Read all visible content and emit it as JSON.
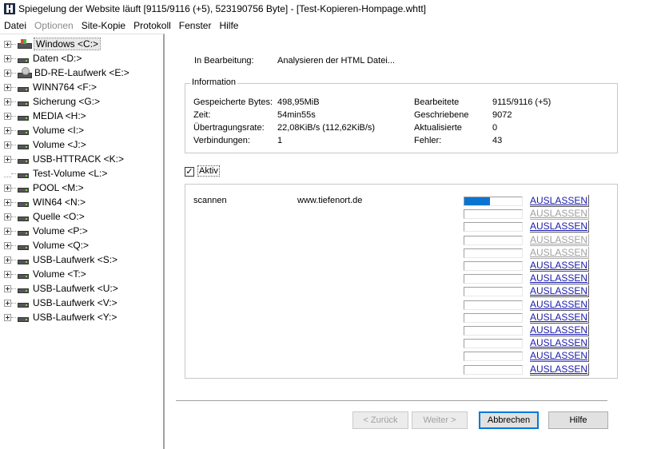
{
  "window": {
    "title": "Spiegelung der Website läuft [9115/9116 (+5), 523190756 Byte] - [Test-Kopieren-Hompage.whtt]"
  },
  "menu": [
    {
      "label": "Datei",
      "disabled": false
    },
    {
      "label": "Optionen",
      "disabled": true
    },
    {
      "label": "Site-Kopie",
      "disabled": false
    },
    {
      "label": "Protokoll",
      "disabled": false
    },
    {
      "label": "Fenster",
      "disabled": false
    },
    {
      "label": "Hilfe",
      "disabled": false
    }
  ],
  "tree": [
    {
      "label": "Windows <C:>",
      "icon": "windows-drive-icon",
      "expandable": true
    },
    {
      "label": "Daten <D:>",
      "icon": "drive-icon",
      "expandable": true
    },
    {
      "label": "BD-RE-Laufwerk <E:>",
      "icon": "optical-drive-icon",
      "expandable": true
    },
    {
      "label": "WINN764 <F:>",
      "icon": "drive-icon",
      "expandable": true
    },
    {
      "label": "Sicherung <G:>",
      "icon": "drive-icon",
      "expandable": true
    },
    {
      "label": "MEDIA <H:>",
      "icon": "drive-icon",
      "expandable": true
    },
    {
      "label": "Volume <I:>",
      "icon": "drive-icon",
      "expandable": true
    },
    {
      "label": "Volume <J:>",
      "icon": "drive-icon",
      "expandable": true
    },
    {
      "label": "USB-HTTRACK <K:>",
      "icon": "drive-icon",
      "expandable": true
    },
    {
      "label": "Test-Volume <L:>",
      "icon": "drive-icon",
      "expandable": false
    },
    {
      "label": "POOL <M:>",
      "icon": "drive-icon",
      "expandable": true
    },
    {
      "label": "WIN64 <N:>",
      "icon": "drive-icon",
      "expandable": true
    },
    {
      "label": "Quelle <O:>",
      "icon": "drive-icon",
      "expandable": true
    },
    {
      "label": "Volume <P:>",
      "icon": "drive-icon",
      "expandable": true
    },
    {
      "label": "Volume <Q:>",
      "icon": "drive-icon",
      "expandable": true
    },
    {
      "label": "USB-Laufwerk <S:>",
      "icon": "drive-icon",
      "expandable": true
    },
    {
      "label": "Volume <T:>",
      "icon": "drive-icon",
      "expandable": true
    },
    {
      "label": "USB-Laufwerk <U:>",
      "icon": "drive-icon",
      "expandable": true
    },
    {
      "label": "USB-Laufwerk <V:>",
      "icon": "drive-icon",
      "expandable": true
    },
    {
      "label": "USB-Laufwerk <Y:>",
      "icon": "drive-icon",
      "expandable": true
    }
  ],
  "status": {
    "label": "In Bearbeitung:",
    "value": "Analysieren der HTML Datei..."
  },
  "info": {
    "title": "Information",
    "left": [
      {
        "label": "Gespeicherte Bytes:",
        "value": "498,95MiB"
      },
      {
        "label": "Zeit:",
        "value": "54min55s"
      },
      {
        "label": "Übertragungsrate:",
        "value": "22,08KiB/s (112,62KiB/s)"
      },
      {
        "label": "Verbindungen:",
        "value": "1"
      }
    ],
    "right": [
      {
        "label": "Bearbeitete",
        "value": "9115/9116 (+5)"
      },
      {
        "label": "Geschriebene",
        "value": "9072"
      },
      {
        "label": "Aktualisierte",
        "value": "0"
      },
      {
        "label": "Fehler:",
        "value": "43"
      }
    ]
  },
  "active": {
    "label": "Aktiv",
    "checked_mark": "✓"
  },
  "transfers": [
    {
      "action": "scannen",
      "url": "www.tiefenort.de",
      "progress": 0.45,
      "skip_label": "AUSLASSEN",
      "skip_enabled": true
    },
    {
      "action": "",
      "url": "",
      "progress": 0,
      "skip_label": "AUSLASSEN",
      "skip_enabled": false
    },
    {
      "action": "",
      "url": "",
      "progress": 0,
      "skip_label": "AUSLASSEN",
      "skip_enabled": true
    },
    {
      "action": "",
      "url": "",
      "progress": 0,
      "skip_label": "AUSLASSEN",
      "skip_enabled": false
    },
    {
      "action": "",
      "url": "",
      "progress": 0,
      "skip_label": "AUSLASSEN",
      "skip_enabled": false
    },
    {
      "action": "",
      "url": "",
      "progress": 0,
      "skip_label": "AUSLASSEN",
      "skip_enabled": true
    },
    {
      "action": "",
      "url": "",
      "progress": 0,
      "skip_label": "AUSLASSEN",
      "skip_enabled": true
    },
    {
      "action": "",
      "url": "",
      "progress": 0,
      "skip_label": "AUSLASSEN",
      "skip_enabled": true
    },
    {
      "action": "",
      "url": "",
      "progress": 0,
      "skip_label": "AUSLASSEN",
      "skip_enabled": true
    },
    {
      "action": "",
      "url": "",
      "progress": 0,
      "skip_label": "AUSLASSEN",
      "skip_enabled": true
    },
    {
      "action": "",
      "url": "",
      "progress": 0,
      "skip_label": "AUSLASSEN",
      "skip_enabled": true
    },
    {
      "action": "",
      "url": "",
      "progress": 0,
      "skip_label": "AUSLASSEN",
      "skip_enabled": true
    },
    {
      "action": "",
      "url": "",
      "progress": 0,
      "skip_label": "AUSLASSEN",
      "skip_enabled": true
    },
    {
      "action": "",
      "url": "",
      "progress": 0,
      "skip_label": "AUSLASSEN",
      "skip_enabled": true
    }
  ],
  "buttons": {
    "back": "< Zurück",
    "next": "Weiter >",
    "cancel": "Abbrechen",
    "help": "Hilfe"
  },
  "colors": {
    "progress_fill": "#0b74d2",
    "link": "#1a1aaa"
  }
}
